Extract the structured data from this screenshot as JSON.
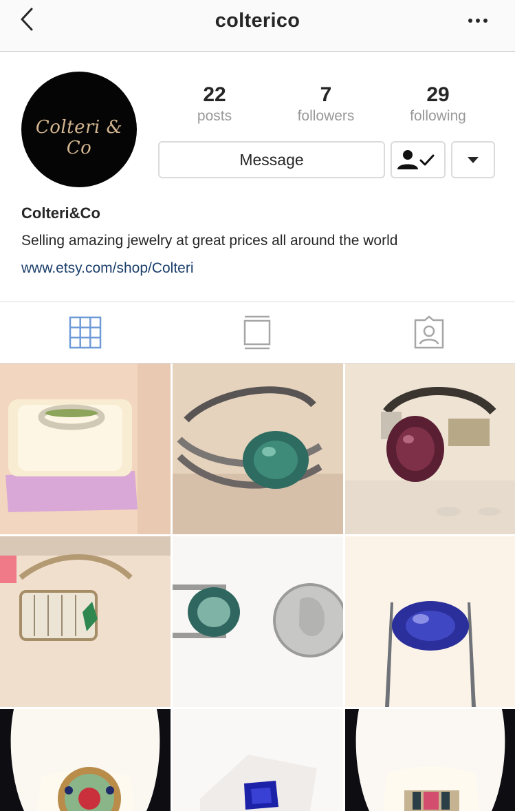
{
  "header": {
    "username": "colterico",
    "back_icon": "chevron-left-icon",
    "more_icon": "ellipsis-icon"
  },
  "profile": {
    "avatar_text": "Colteri & Co",
    "stats": [
      {
        "value": "22",
        "label": "posts"
      },
      {
        "value": "7",
        "label": "followers"
      },
      {
        "value": "29",
        "label": "following"
      }
    ],
    "message_label": "Message",
    "display_name": "Colteri&Co",
    "bio": "Selling amazing jewelry at great prices all around the world",
    "website": "www.etsy.com/shop/Colteri"
  },
  "tabs": [
    {
      "icon": "grid-icon",
      "active": true
    },
    {
      "icon": "feed-icon",
      "active": false
    },
    {
      "icon": "tagged-icon",
      "active": false
    }
  ],
  "colors": {
    "active_tab": "#6f9ad8",
    "inactive_tab": "#a6a6a6",
    "link": "#1b3e6b"
  },
  "posts": [
    {
      "name": "post-ring-green-band-in-box"
    },
    {
      "name": "post-ring-teal-stone"
    },
    {
      "name": "post-ring-purple-stone"
    },
    {
      "name": "post-ring-baguette-green"
    },
    {
      "name": "post-gem-with-dime"
    },
    {
      "name": "post-blue-gem-tweezers"
    },
    {
      "name": "post-ring-ruby-emerald-cluster"
    },
    {
      "name": "post-blue-emerald-cut-gem"
    },
    {
      "name": "post-ring-ruby-channel"
    }
  ]
}
